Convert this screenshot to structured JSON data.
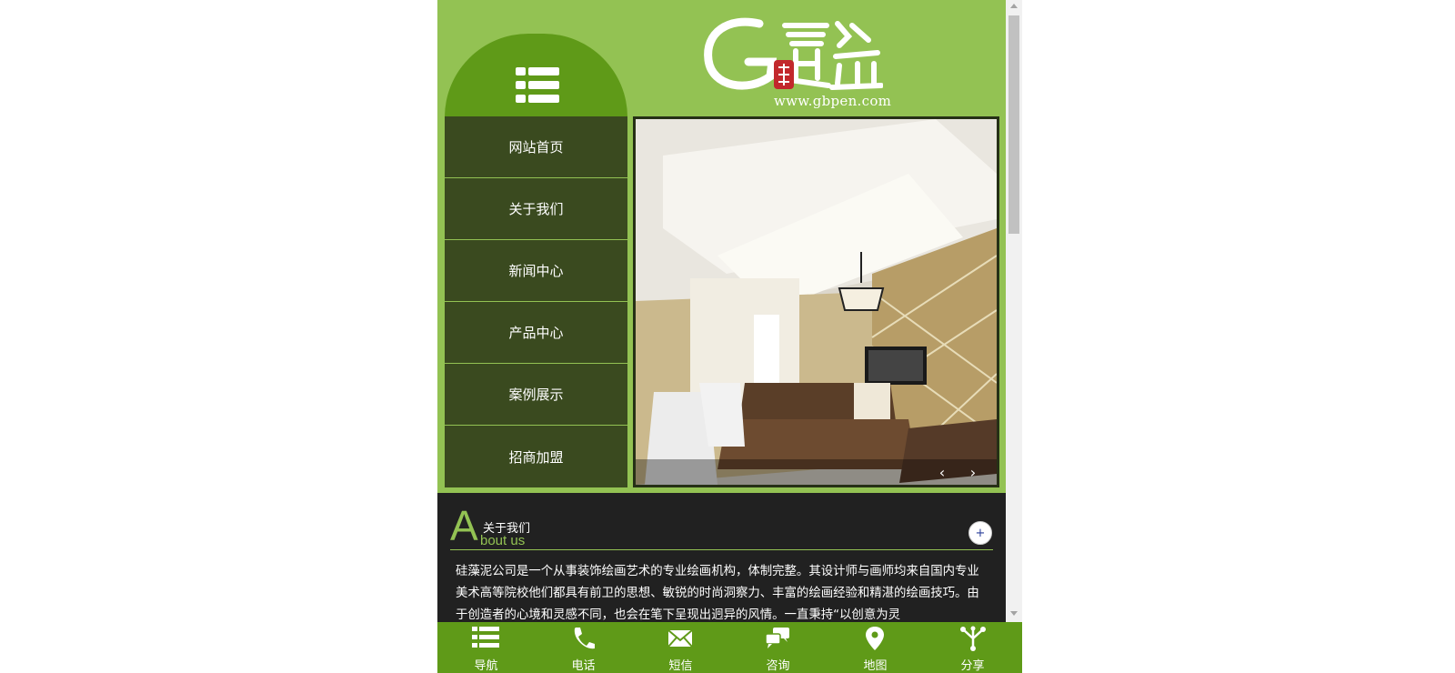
{
  "logo": {
    "url_text": "www.gbpen.com"
  },
  "nav": {
    "items": [
      {
        "label": "网站首页"
      },
      {
        "label": "关于我们"
      },
      {
        "label": "新闻中心"
      },
      {
        "label": "产品中心"
      },
      {
        "label": "案例展示"
      },
      {
        "label": "招商加盟"
      }
    ]
  },
  "banner": {
    "prev": "‹",
    "next": "›"
  },
  "about": {
    "letter": "A",
    "title_cn": "关于我们",
    "title_en": "bout us",
    "more": "+",
    "body": "硅藻泥公司是一个从事装饰绘画艺术的专业绘画机构，体制完整。其设计师与画师均来自国内专业美术高等院校他们都具有前卫的思想、敏锐的时尚洞察力、丰富的绘画经验和精湛的绘画技巧。由于创造者的心境和灵感不同，也会在笔下呈现出迥异的风情。一直秉持“以创意为灵"
  },
  "footer": {
    "items": [
      {
        "label": "导航",
        "icon": "list-icon"
      },
      {
        "label": "电话",
        "icon": "phone-icon"
      },
      {
        "label": "短信",
        "icon": "mail-icon"
      },
      {
        "label": "咨询",
        "icon": "chat-icon"
      },
      {
        "label": "地图",
        "icon": "map-pin-icon"
      },
      {
        "label": "分享",
        "icon": "share-icon"
      }
    ]
  },
  "colors": {
    "header_green": "#93c253",
    "dark_green": "#5f9a18",
    "nav_bg": "#3a4a1f",
    "about_bg": "#212121"
  }
}
